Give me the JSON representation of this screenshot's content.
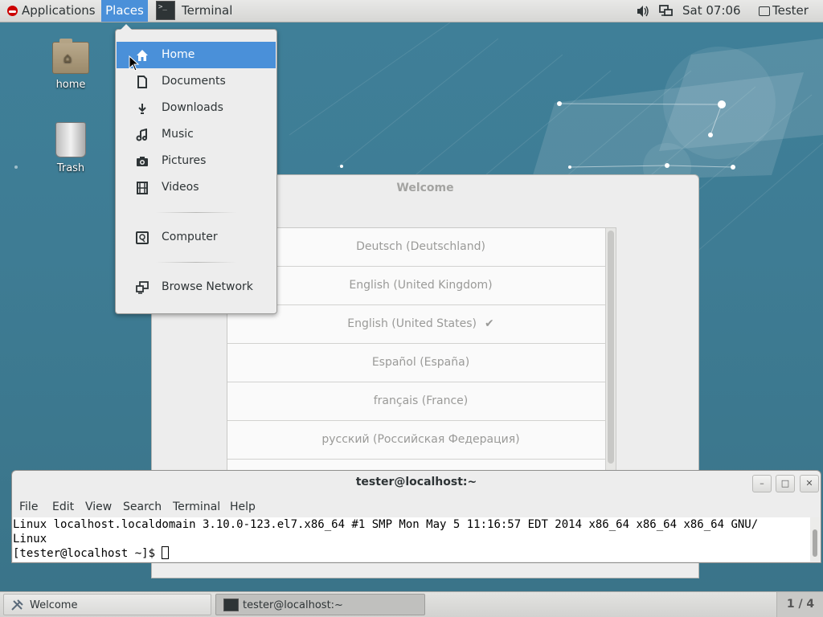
{
  "top_panel": {
    "applications_label": "Applications",
    "places_label": "Places",
    "terminal_task_label": "Terminal",
    "clock": "Sat 07:06",
    "user": "Tester"
  },
  "desktop": {
    "icons": [
      {
        "label": "home"
      },
      {
        "label": "Trash"
      }
    ]
  },
  "places_menu": {
    "items": [
      {
        "label": "Home",
        "icon": "home-icon"
      },
      {
        "label": "Documents",
        "icon": "document-icon"
      },
      {
        "label": "Downloads",
        "icon": "download-icon"
      },
      {
        "label": "Music",
        "icon": "music-icon"
      },
      {
        "label": "Pictures",
        "icon": "camera-icon"
      },
      {
        "label": "Videos",
        "icon": "film-icon"
      },
      {
        "label": "Computer",
        "icon": "computer-icon"
      },
      {
        "label": "Browse Network",
        "icon": "network-icon"
      }
    ]
  },
  "welcome": {
    "title": "Welcome",
    "languages": [
      "Deutsch (Deutschland)",
      "English (United Kingdom)",
      "English (United States)",
      "Español (España)",
      "français (France)",
      "русский (Российская Федерация)"
    ],
    "selected_check": "✔"
  },
  "terminal": {
    "title": "tester@localhost:~",
    "menu": [
      "File",
      "Edit",
      "View",
      "Search",
      "Terminal",
      "Help"
    ],
    "line1": "Linux localhost.localdomain 3.10.0-123.el7.x86_64 #1 SMP Mon May 5 11:16:57 EDT 2014 x86_64 x86_64 x86_64 GNU/",
    "line2": "Linux",
    "prompt": "[tester@localhost ~]$ "
  },
  "bottom_panel": {
    "task_welcome": "Welcome",
    "task_terminal": "tester@localhost:~",
    "workspace": "1 / 4"
  },
  "colors": {
    "accent": "#4a90d9",
    "desktop": "#3f7f98"
  }
}
